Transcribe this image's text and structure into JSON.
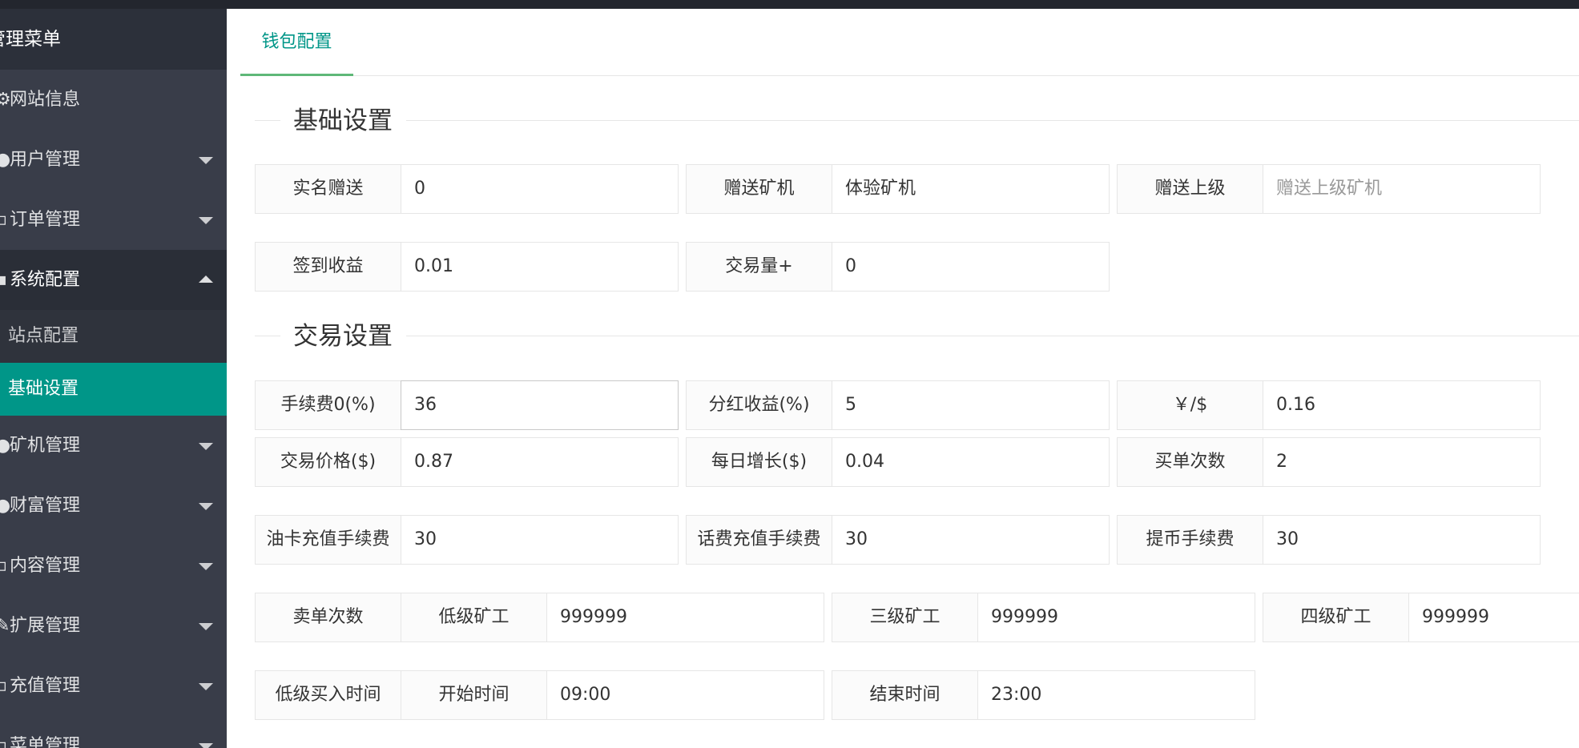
{
  "sidebar": {
    "title": "管理菜单",
    "items": [
      {
        "label": "网站信息",
        "icon": "gear-icon",
        "caret": "none"
      },
      {
        "label": "用户管理",
        "icon": "users-icon",
        "caret": "down"
      },
      {
        "label": "订单管理",
        "icon": "order-icon",
        "caret": "down"
      },
      {
        "label": "系统配置",
        "icon": "grid-icon",
        "caret": "up"
      },
      {
        "label": "矿机管理",
        "icon": "miner-icon",
        "caret": "down"
      },
      {
        "label": "财富管理",
        "icon": "wealth-icon",
        "caret": "down"
      },
      {
        "label": "内容管理",
        "icon": "content-icon",
        "caret": "down"
      },
      {
        "label": "扩展管理",
        "icon": "extend-icon",
        "caret": "down"
      },
      {
        "label": "充值管理",
        "icon": "recharge-icon",
        "caret": "down"
      },
      {
        "label": "菜单管理",
        "icon": "menu-icon",
        "caret": "down"
      }
    ],
    "sub_items": [
      {
        "label": "站点配置"
      },
      {
        "label": "基础设置"
      }
    ]
  },
  "tabs": [
    {
      "label": "钱包配置"
    }
  ],
  "sections": {
    "basic": "基础设置",
    "trade": "交易设置"
  },
  "basic": {
    "realname_gift": {
      "label": "实名赠送",
      "value": "0"
    },
    "gift_miner": {
      "label": "赠送矿机",
      "value": "体验矿机"
    },
    "gift_superior": {
      "label": "赠送上级",
      "value": "",
      "placeholder": "赠送上级矿机"
    },
    "checkin_income": {
      "label": "签到收益",
      "value": "0.01"
    },
    "trade_volume": {
      "label": "交易量+",
      "value": "0"
    }
  },
  "trade": {
    "fee0": {
      "label": "手续费0(%)",
      "value": "36"
    },
    "dividend": {
      "label": "分红收益(%)",
      "value": "5"
    },
    "rate": {
      "label": "￥/$",
      "value": "0.16"
    },
    "price": {
      "label": "交易价格($)",
      "value": "0.87"
    },
    "daily_growth": {
      "label": "每日增长($)",
      "value": "0.04"
    },
    "buy_times": {
      "label": "买单次数",
      "value": "2"
    },
    "oilcard": {
      "label": "油卡充值手续费",
      "value": "30"
    },
    "phone": {
      "label": "话费充值手续费",
      "value": "30"
    },
    "withdraw": {
      "label": "提币手续费",
      "value": "30"
    },
    "sell_times": {
      "label": "卖单次数",
      "low": {
        "label": "低级矿工",
        "value": "999999"
      },
      "level3": {
        "label": "三级矿工",
        "value": "999999"
      },
      "level4": {
        "label": "四级矿工",
        "value": "999999"
      }
    },
    "low_buy": {
      "label": "低级买入时间",
      "start": {
        "label": "开始时间",
        "value": "09:00"
      },
      "end": {
        "label": "结束时间",
        "value": "23:00"
      }
    }
  },
  "colors": {
    "accent": "#009688",
    "sidebar": "#393d49",
    "tab_underline": "#5fb878"
  }
}
